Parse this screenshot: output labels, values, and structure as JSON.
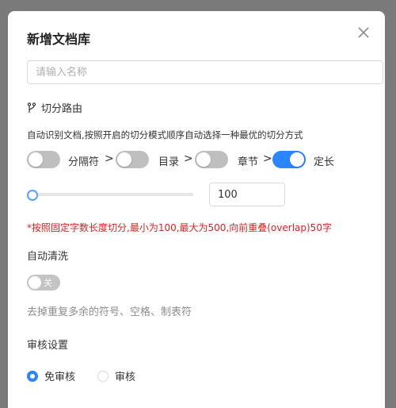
{
  "dialog": {
    "title": "新增文档库",
    "close_icon": "close-icon"
  },
  "name_input": {
    "placeholder": "请输入名称",
    "value": ""
  },
  "route": {
    "icon": "branch-icon",
    "label": "切分路由",
    "description": "自动识别文档,按照开启的切分模式顺序自动选择一种最优的切分方式",
    "modes": [
      {
        "label": "分隔符",
        "on": false
      },
      {
        "label": "目录",
        "on": false
      },
      {
        "label": "章节",
        "on": false
      },
      {
        "label": "定长",
        "on": true
      }
    ],
    "separator": ">"
  },
  "chunk_size": {
    "value": "100",
    "min": 100,
    "max": 500,
    "note": "*按照固定字数长度切分,最小为100,最大为500,向前重叠(overlap)50字"
  },
  "auto_clean": {
    "label": "自动清洗",
    "switch_text": "关",
    "on": false,
    "description": "去掉重复多余的符号、空格、制表符"
  },
  "review": {
    "label": "审核设置",
    "options": [
      {
        "label": "免审核",
        "checked": true
      },
      {
        "label": "审核",
        "checked": false
      }
    ]
  },
  "colors": {
    "accent": "#2a85ff",
    "warning": "#e02020"
  }
}
